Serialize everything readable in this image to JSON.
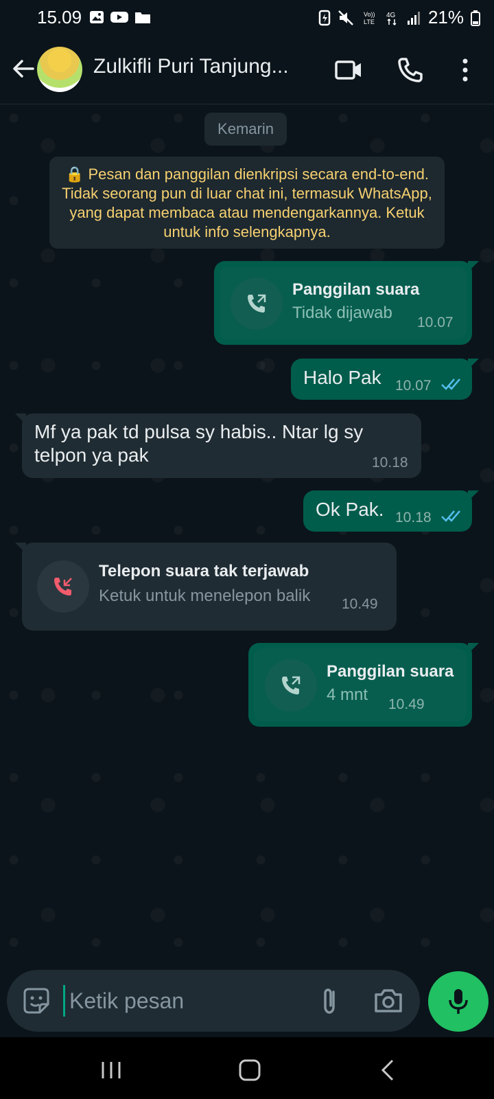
{
  "status_bar": {
    "time": "15.09",
    "battery": "21%"
  },
  "header": {
    "contact_name": "Zulkifli Puri Tanjung..."
  },
  "chat": {
    "date_chip": "Kemarin",
    "encryption_notice": "🔒 Pesan dan panggilan dienkripsi secara end-to-end. Tidak seorang pun di luar chat ini, termasuk WhatsApp, yang dapat membaca atau mendengarkannya. Ketuk untuk info selengkapnya.",
    "messages": [
      {
        "type": "call_out",
        "title": "Panggilan suara",
        "subtitle": "Tidak dijawab",
        "time": "10.07"
      },
      {
        "type": "text_out",
        "text": "Halo Pak",
        "time": "10.07",
        "read": true
      },
      {
        "type": "text_in",
        "text": "Mf ya pak td pulsa sy habis.. Ntar lg sy telpon ya pak",
        "time": "10.18"
      },
      {
        "type": "text_out",
        "text": "Ok Pak.",
        "time": "10.18",
        "read": true
      },
      {
        "type": "call_missed_in",
        "title": "Telepon suara tak terjawab",
        "subtitle": "Ketuk untuk menelepon balik",
        "time": "10.49"
      },
      {
        "type": "call_out",
        "title": "Panggilan suara",
        "subtitle": "4 mnt",
        "time": "10.49"
      }
    ]
  },
  "input": {
    "placeholder": "Ketik pesan"
  },
  "colors": {
    "outgoing_bubble": "#005c4b",
    "incoming_bubble": "#202c33",
    "mic_button": "#21c063",
    "missed_call_red": "#f15c6d",
    "read_tick_blue": "#53bdeb"
  }
}
